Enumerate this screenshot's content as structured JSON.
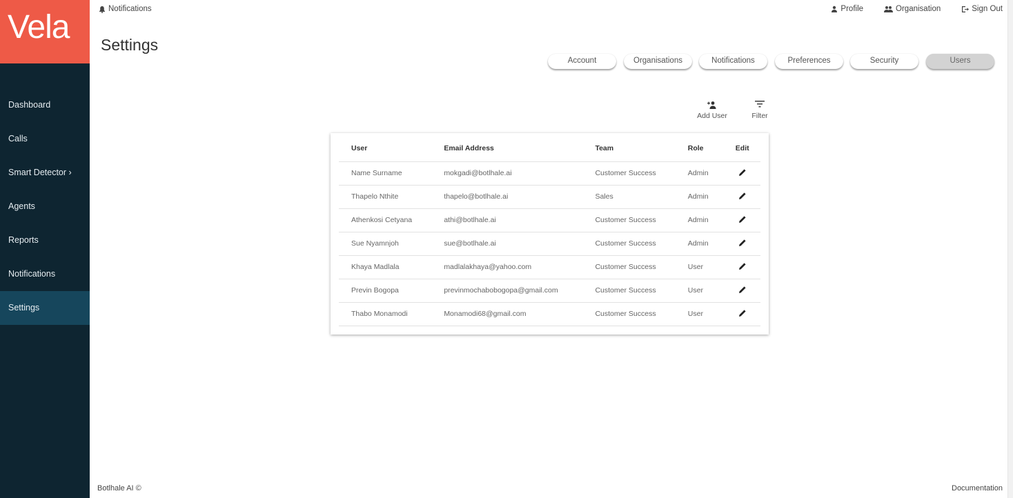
{
  "app": {
    "logo": "Vela"
  },
  "sidebar": {
    "items": [
      {
        "label": "Dashboard"
      },
      {
        "label": "Calls"
      },
      {
        "label": "Smart Detector ›"
      },
      {
        "label": "Agents"
      },
      {
        "label": "Reports"
      },
      {
        "label": "Notifications"
      },
      {
        "label": "Settings",
        "active": true
      }
    ]
  },
  "header": {
    "notifications": "Notifications",
    "profile": "Profile",
    "organisation": "Organisation",
    "sign_out": "Sign Out"
  },
  "page": {
    "title": "Settings"
  },
  "tabs": [
    {
      "label": "Account"
    },
    {
      "label": "Organisations"
    },
    {
      "label": "Notifications"
    },
    {
      "label": "Preferences"
    },
    {
      "label": "Security"
    },
    {
      "label": "Users",
      "active": true
    }
  ],
  "actions": {
    "add_user": "Add User",
    "filter": "Filter"
  },
  "table": {
    "headers": {
      "user": "User",
      "email": "Email Address",
      "team": "Team",
      "role": "Role",
      "edit": "Edit"
    },
    "rows": [
      {
        "user": "Name Surname",
        "email": "mokgadi@botlhale.ai",
        "team": "Customer Success",
        "role": "Admin"
      },
      {
        "user": "Thapelo Nthite",
        "email": "thapelo@botlhale.ai",
        "team": "Sales",
        "role": "Admin"
      },
      {
        "user": "Athenkosi Cetyana",
        "email": "athi@botlhale.ai",
        "team": "Customer Success",
        "role": "Admin"
      },
      {
        "user": "Sue Nyamnjoh",
        "email": "sue@botlhale.ai",
        "team": "Customer Success",
        "role": "Admin"
      },
      {
        "user": "Khaya Madlala",
        "email": "madlalakhaya@yahoo.com",
        "team": "Customer Success",
        "role": "User"
      },
      {
        "user": "Previn Bogopa",
        "email": "previnmochabobogopa@gmail.com",
        "team": "Customer Success",
        "role": "User"
      },
      {
        "user": "Thabo Monamodi",
        "email": "Monamodi68@gmail.com",
        "team": "Customer Success",
        "role": "User"
      }
    ]
  },
  "footer": {
    "company": "Botlhale AI ©",
    "documentation": "Documentation"
  },
  "colors": {
    "brand": "#ee5a47",
    "sidebar": "#0e2531",
    "sidebar_active": "#16465c",
    "tab_active": "#d3d3d3"
  }
}
